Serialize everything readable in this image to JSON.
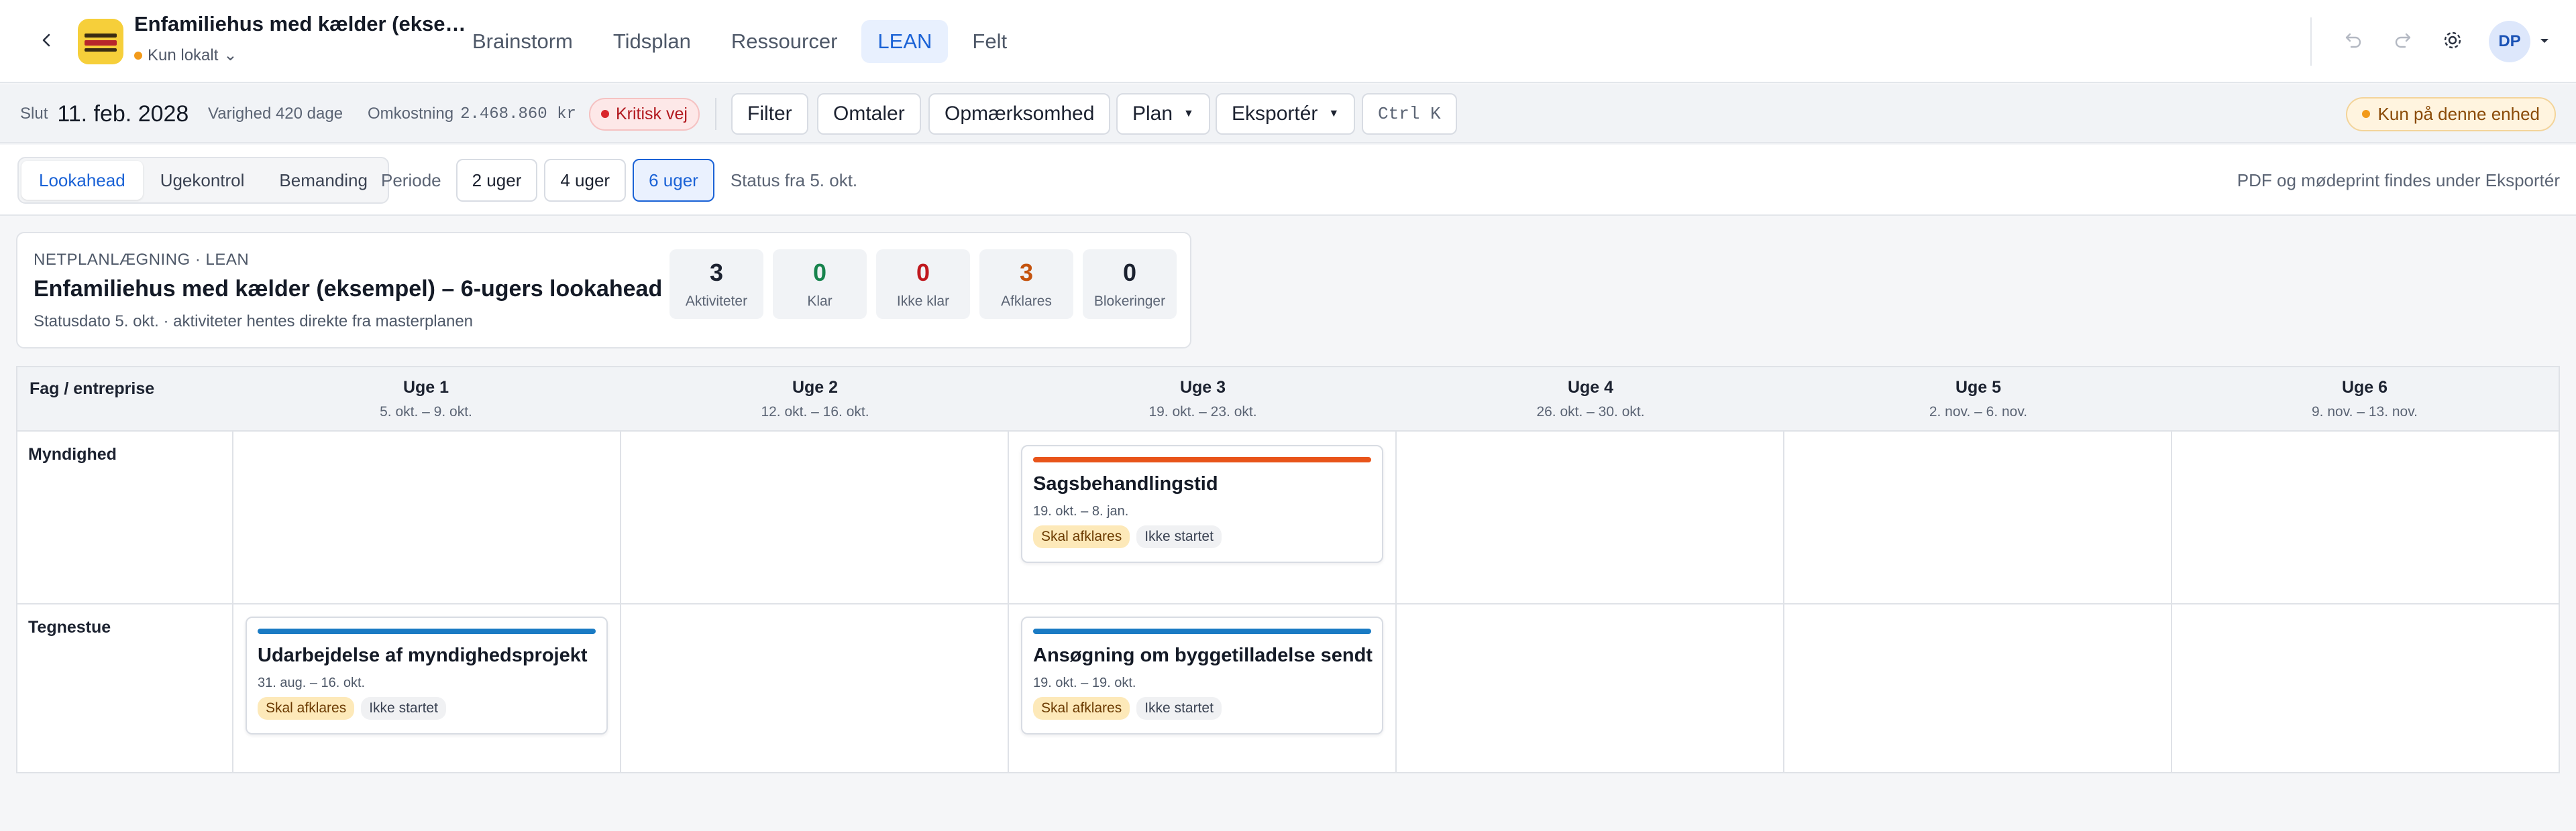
{
  "header": {
    "project_title": "Enfamiliehus med kælder (ekse…",
    "storage_label": "Kun lokalt",
    "storage_caret": "⌄",
    "tabs": [
      {
        "label": "Brainstorm"
      },
      {
        "label": "Tidsplan"
      },
      {
        "label": "Ressourcer"
      },
      {
        "label": "LEAN"
      },
      {
        "label": "Felt"
      }
    ],
    "active_tab": "LEAN",
    "avatar_initials": "DP"
  },
  "toolbar": {
    "end_label": "Slut",
    "end_date": "11. feb. 2028",
    "duration_label": "Varighed 420 dage",
    "cost_label": "Omkostning",
    "cost_value": "2.468.860 kr",
    "critical_label": "Kritisk vej",
    "filter_label": "Filter",
    "comments_label": "Omtaler",
    "attention_label": "Opmærksomhed",
    "plan_label": "Plan",
    "export_label": "Eksportér",
    "shortcut": "Ctrl K",
    "device_badge": "Kun på denne enhed"
  },
  "subbar": {
    "views": [
      {
        "label": "Lookahead"
      },
      {
        "label": "Ugekontrol"
      },
      {
        "label": "Bemanding"
      }
    ],
    "period_label": "Periode",
    "periods": [
      {
        "label": "2 uger"
      },
      {
        "label": "4 uger"
      },
      {
        "label": "6 uger"
      }
    ],
    "status_from": "Status fra 5. okt.",
    "pdf_note": "PDF og mødeprint findes under Eksportér"
  },
  "info": {
    "kicker": "NETPLANLÆGNING · LEAN",
    "title": "Enfamiliehus med kælder (eksempel) – 6-ugers lookahead",
    "subtitle": "Statusdato 5. okt. · aktiviteter hentes direkte fra masterplanen",
    "stats": [
      {
        "value": "3",
        "label": "Aktiviteter",
        "color": "#1c2230"
      },
      {
        "value": "0",
        "label": "Klar",
        "color": "#17834d"
      },
      {
        "value": "0",
        "label": "Ikke klar",
        "color": "#c0181e"
      },
      {
        "value": "3",
        "label": "Afklares",
        "color": "#c4530e"
      },
      {
        "value": "0",
        "label": "Blokeringer",
        "color": "#1c2230"
      }
    ]
  },
  "grid": {
    "corner_label": "Fag / entreprise",
    "weeks": [
      {
        "name": "Uge 1",
        "range": "5. okt. – 9. okt."
      },
      {
        "name": "Uge 2",
        "range": "12. okt. – 16. okt."
      },
      {
        "name": "Uge 3",
        "range": "19. okt. – 23. okt."
      },
      {
        "name": "Uge 4",
        "range": "26. okt. – 30. okt."
      },
      {
        "name": "Uge 5",
        "range": "2. nov. – 6. nov."
      },
      {
        "name": "Uge 6",
        "range": "9. nov. – 13. nov."
      }
    ],
    "rows": [
      {
        "label": "Myndighed"
      },
      {
        "label": "Tegnestue"
      }
    ],
    "tasks": [
      {
        "title": "Sagsbehandlingstid",
        "dates": "19. okt. – 8. jan.",
        "tag1": "Skal afklares",
        "tag2": "Ikke startet",
        "bar_color": "#e8541a"
      },
      {
        "title": "Udarbejdelse af myndighedsprojekt",
        "dates": "31. aug. – 16. okt.",
        "tag1": "Skal afklares",
        "tag2": "Ikke startet",
        "bar_color": "#1a7bc4"
      },
      {
        "title": "Ansøgning om byggetilladelse sendt",
        "dates": "19. okt. – 19. okt.",
        "tag1": "Skal afklares",
        "tag2": "Ikke startet",
        "bar_color": "#1a7bc4"
      }
    ]
  }
}
